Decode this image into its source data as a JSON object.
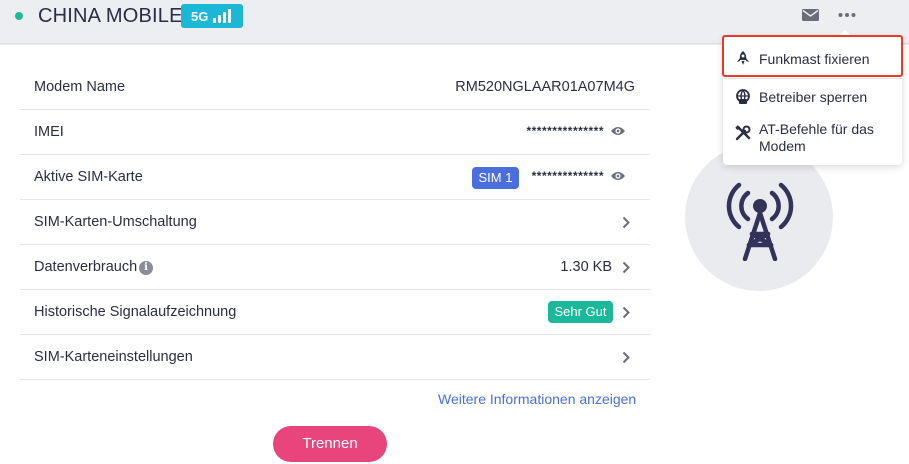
{
  "header": {
    "carrier": "CHINA MOBILE",
    "network_type": "5G",
    "signal_bars": 4,
    "status_color": "#1bb89a"
  },
  "rows": [
    {
      "label": "Modem Name",
      "value": "RM520NGLAAR01A07M4G"
    },
    {
      "label": "IMEI",
      "masked_value": "***************"
    },
    {
      "label": "Aktive SIM-Karte",
      "badge": "SIM 1",
      "masked_value": "**************"
    },
    {
      "label": "SIM-Karten-Umschaltung"
    },
    {
      "label": "Datenverbrauch",
      "value": "1.30 KB"
    },
    {
      "label": "Historische Signalaufzeichnung",
      "badge": "Sehr Gut"
    },
    {
      "label": "SIM-Karteneinstellungen"
    }
  ],
  "links": {
    "more_info": "Weitere Informationen anzeigen"
  },
  "buttons": {
    "disconnect": "Trennen"
  },
  "menu": {
    "items": [
      {
        "label": "Funkmast fixieren",
        "icon": "rocket-icon",
        "highlighted": true
      },
      {
        "label": "Betreiber sperren",
        "icon": "globe-lock-icon"
      },
      {
        "label": "AT-Befehle für das Modem",
        "icon": "tools-icon"
      }
    ]
  },
  "colors": {
    "accent": "#4a6fdc",
    "badge_5g": "#1cb6d6",
    "good": "#1bb89a",
    "disconnect": "#e8457c",
    "highlight": "#e53a2c"
  }
}
